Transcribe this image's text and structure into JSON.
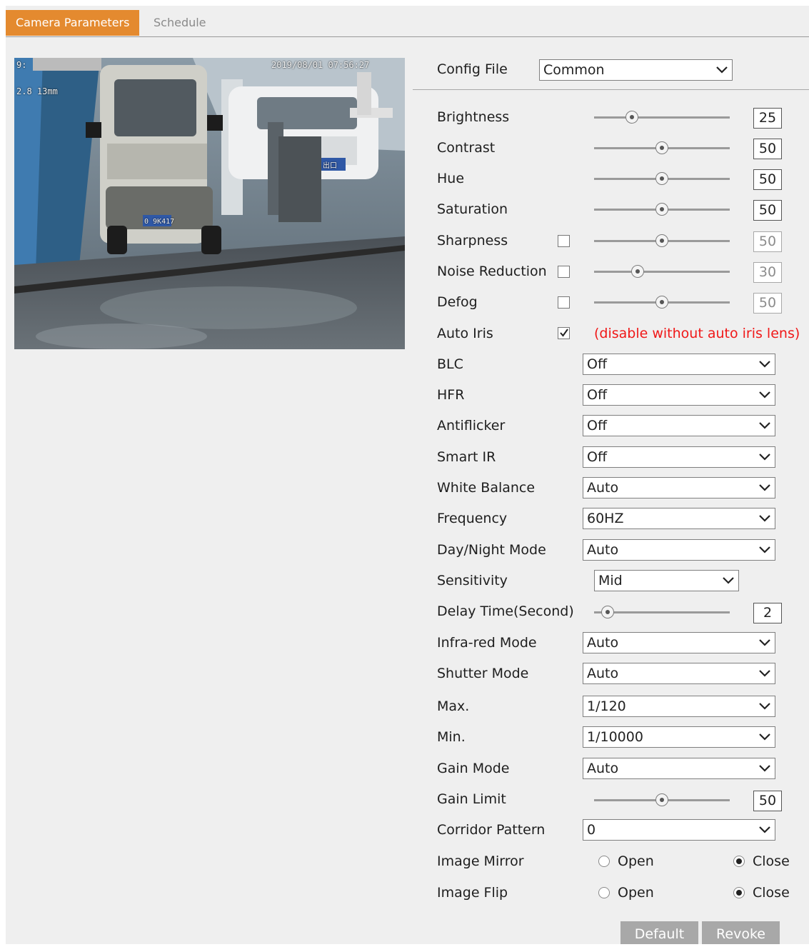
{
  "tabs": {
    "active": "Camera Parameters",
    "inactive": "Schedule"
  },
  "osd": {
    "top_left": "9:",
    "top_right": "2019/08/01 07:56:27",
    "lens": "2.8 13mm",
    "plate": "0 9K417",
    "plate_sign": "出口"
  },
  "config_file": {
    "label": "Config File",
    "value": "Common"
  },
  "sliders": {
    "brightness": {
      "label": "Brightness",
      "value": "25",
      "level": 0.25
    },
    "contrast": {
      "label": "Contrast",
      "value": "50",
      "level": 0.5
    },
    "hue": {
      "label": "Hue",
      "value": "50",
      "level": 0.5
    },
    "saturation": {
      "label": "Saturation",
      "value": "50",
      "level": 0.5
    },
    "sharpness": {
      "label": "Sharpness",
      "value": "50",
      "level": 0.5
    },
    "noise_reduction": {
      "label": "Noise Reduction",
      "value": "30",
      "level": 0.3
    },
    "defog": {
      "label": "Defog",
      "value": "50",
      "level": 0.5
    },
    "delay_time": {
      "label": "Delay Time(Second)",
      "value": "2",
      "level": 0.05
    },
    "gain_limit": {
      "label": "Gain Limit",
      "value": "50",
      "level": 0.5
    }
  },
  "auto_iris": {
    "label": "Auto Iris",
    "note": "(disable without auto iris lens)"
  },
  "selects": {
    "blc": {
      "label": "BLC",
      "value": "Off"
    },
    "hfr": {
      "label": "HFR",
      "value": "Off"
    },
    "antiflicker": {
      "label": "Antiflicker",
      "value": "Off"
    },
    "smart_ir": {
      "label": "Smart IR",
      "value": "Off"
    },
    "white_balance": {
      "label": "White Balance",
      "value": "Auto"
    },
    "frequency": {
      "label": "Frequency",
      "value": "60HZ"
    },
    "day_night": {
      "label": "Day/Night Mode",
      "value": "Auto"
    },
    "sensitivity": {
      "label": "Sensitivity",
      "value": "Mid"
    },
    "infrared": {
      "label": "Infra-red Mode",
      "value": "Auto"
    },
    "shutter": {
      "label": "Shutter Mode",
      "value": "Auto"
    },
    "max": {
      "label": "Max.",
      "value": "1/120"
    },
    "min": {
      "label": "Min.",
      "value": "1/10000"
    },
    "gain_mode": {
      "label": "Gain Mode",
      "value": "Auto"
    },
    "corridor": {
      "label": "Corridor Pattern",
      "value": "0"
    }
  },
  "image_mirror": {
    "label": "Image Mirror",
    "open": "Open",
    "close": "Close"
  },
  "image_flip": {
    "label": "Image Flip",
    "open": "Open",
    "close": "Close"
  },
  "buttons": {
    "default": "Default",
    "revoke": "Revoke"
  },
  "colors": {
    "accent": "#e48a2f",
    "warning": "#f01818",
    "button": "#a8a8a8",
    "panel": "#efefef"
  }
}
